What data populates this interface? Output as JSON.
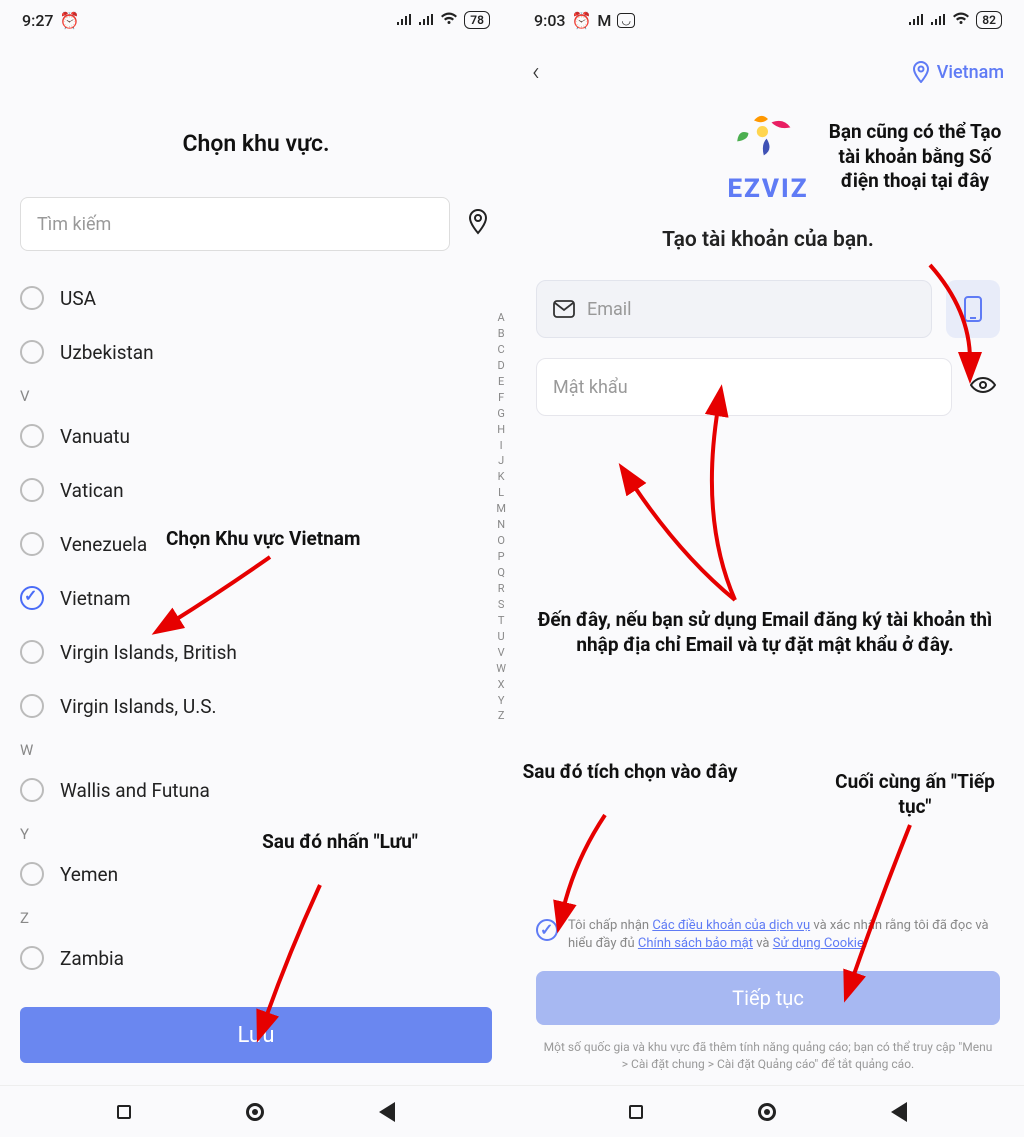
{
  "left": {
    "status": {
      "time": "9:27",
      "battery": "78"
    },
    "title": "Chọn khu vực.",
    "search_placeholder": "Tìm kiếm",
    "countries": [
      {
        "label": "USA",
        "selected": false
      },
      {
        "label": "Uzbekistan",
        "selected": false
      }
    ],
    "section_v": "V",
    "countries_v": [
      {
        "label": "Vanuatu",
        "selected": false
      },
      {
        "label": "Vatican",
        "selected": false
      },
      {
        "label": "Venezuela",
        "selected": false
      },
      {
        "label": "Vietnam",
        "selected": true
      },
      {
        "label": "Virgin Islands, British",
        "selected": false
      },
      {
        "label": "Virgin Islands, U.S.",
        "selected": false
      }
    ],
    "section_w": "W",
    "countries_w": [
      {
        "label": "Wallis and Futuna",
        "selected": false
      }
    ],
    "section_y": "Y",
    "countries_y": [
      {
        "label": "Yemen",
        "selected": false
      }
    ],
    "section_z": "Z",
    "countries_z": [
      {
        "label": "Zambia",
        "selected": false
      }
    ],
    "alpha": [
      "A",
      "B",
      "C",
      "D",
      "E",
      "F",
      "G",
      "H",
      "I",
      "J",
      "K",
      "L",
      "M",
      "N",
      "O",
      "P",
      "Q",
      "R",
      "S",
      "T",
      "U",
      "V",
      "W",
      "X",
      "Y",
      "Z"
    ],
    "save_label": "Lưu"
  },
  "right": {
    "status": {
      "time": "9:03",
      "battery": "82"
    },
    "region_label": "Vietnam",
    "brand": "EZVIZ",
    "title": "Tạo tài khoản của bạn.",
    "email_placeholder": "Email",
    "password_placeholder": "Mật khẩu",
    "terms_prefix": "Tôi chấp nhận ",
    "terms_link1": "Các điều khoản của dịch vụ",
    "terms_mid1": " và xác nhận rằng tôi đã đọc và hiểu đầy đủ ",
    "terms_link2": "Chính sách bảo mật",
    "terms_mid2": " và ",
    "terms_link3": "Sử dụng Cookie",
    "terms_suffix": ".",
    "continue_label": "Tiếp tục",
    "footnote": "Một số quốc gia và khu vực đã thêm tính năng quảng cáo; bạn có thể truy cập \"Menu > Cài đặt chung > Cài đặt Quảng cáo\" để tắt quảng cáo."
  },
  "annotations": {
    "choose_region": "Chọn Khu vực Vietnam",
    "then_save": "Sau đó nhấn \"Lưu\"",
    "phone_signup": "Bạn cũng có thể Tạo tài khoản bằng Số điện thoại tại đây",
    "email_note": "Đến đây, nếu bạn sử dụng Email đăng ký tài khoản thì nhập địa chỉ Email và tự đặt mật khẩu ở đây.",
    "tick_here": "Sau đó tích chọn vào đây",
    "press_continue": "Cuối cùng ấn \"Tiếp tục\""
  }
}
